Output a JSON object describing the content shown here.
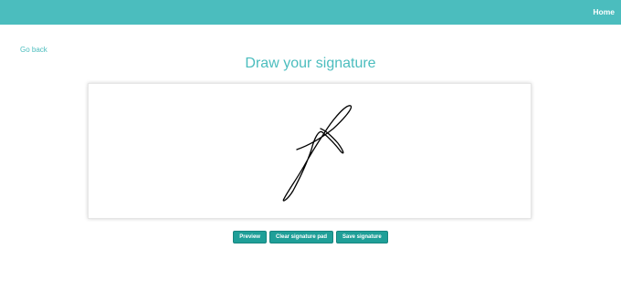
{
  "nav": {
    "home_label": "Home"
  },
  "page": {
    "go_back_label": "Go back",
    "title": "Draw your signature"
  },
  "actions": {
    "preview_label": "Preview",
    "clear_label": "Clear signature pad",
    "save_label": "Save signature"
  },
  "colors": {
    "accent": "#4bbdbe",
    "button": "#1f9f98",
    "ink": "#000000"
  }
}
